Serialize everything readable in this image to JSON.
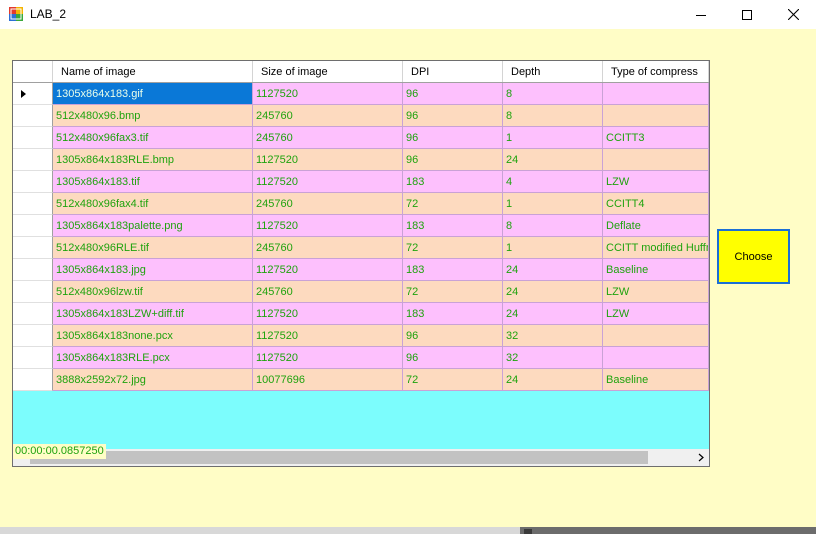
{
  "window": {
    "title": "LAB_2",
    "app_icon": "windows-forms-app-icon",
    "controls": [
      "minimize-icon",
      "maximize-icon",
      "close-icon"
    ]
  },
  "grid": {
    "columns": [
      "Name of image",
      "Size of image",
      "DPI",
      "Depth",
      "Type of compress"
    ],
    "selected_row": 0,
    "rows": [
      {
        "name": "1305x864x183.gif",
        "size": "1127520",
        "dpi": "96",
        "depth": "8",
        "compress": ""
      },
      {
        "name": "512x480x96.bmp",
        "size": "245760",
        "dpi": "96",
        "depth": "8",
        "compress": ""
      },
      {
        "name": "512x480x96fax3.tif",
        "size": "245760",
        "dpi": "96",
        "depth": "1",
        "compress": "CCITT3"
      },
      {
        "name": "1305x864x183RLE.bmp",
        "size": "1127520",
        "dpi": "96",
        "depth": "24",
        "compress": ""
      },
      {
        "name": "1305x864x183.tif",
        "size": "1127520",
        "dpi": "183",
        "depth": "4",
        "compress": "LZW"
      },
      {
        "name": "512x480x96fax4.tif",
        "size": "245760",
        "dpi": "72",
        "depth": "1",
        "compress": "CCITT4"
      },
      {
        "name": "1305x864x183palette.png",
        "size": "1127520",
        "dpi": "183",
        "depth": "8",
        "compress": "Deflate"
      },
      {
        "name": "512x480x96RLE.tif",
        "size": "245760",
        "dpi": "72",
        "depth": "1",
        "compress": "CCITT modified Huffm"
      },
      {
        "name": "1305x864x183.jpg",
        "size": "1127520",
        "dpi": "183",
        "depth": "24",
        "compress": "Baseline"
      },
      {
        "name": "512x480x96lzw.tif",
        "size": "245760",
        "dpi": "72",
        "depth": "24",
        "compress": "LZW"
      },
      {
        "name": "1305x864x183LZW+diff.tif",
        "size": "1127520",
        "dpi": "183",
        "depth": "24",
        "compress": "LZW"
      },
      {
        "name": "1305x864x183none.pcx",
        "size": "1127520",
        "dpi": "96",
        "depth": "32",
        "compress": ""
      },
      {
        "name": "1305x864x183RLE.pcx",
        "size": "1127520",
        "dpi": "96",
        "depth": "32",
        "compress": ""
      },
      {
        "name": "3888x2592x72.jpg",
        "size": "10077696",
        "dpi": "72",
        "depth": "24",
        "compress": "Baseline"
      }
    ]
  },
  "elapsed_time": "00:00:00.0857250",
  "choose_button": {
    "label": "Choose"
  },
  "colors": {
    "form_background": "#fffdc6",
    "grid_background": "#7cfdfd",
    "row_pink": "#fdc0fd",
    "row_peach": "#fddabf",
    "cell_text": "#1fa30e",
    "selection": "#0a78d7",
    "button_yellow": "#ffff00",
    "button_border": "#1a6fd6"
  }
}
